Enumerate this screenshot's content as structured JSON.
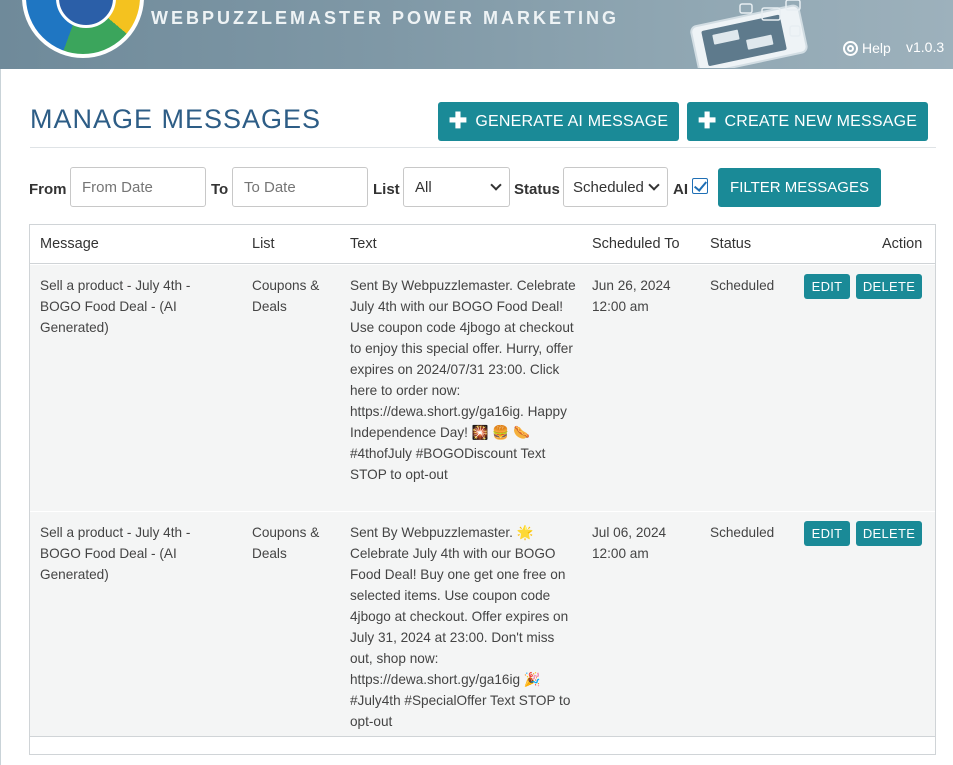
{
  "header": {
    "brand_tagline": "WEBPUZZLEMASTER POWER MARKETING",
    "help_label": "Help",
    "version": "v1.0.3"
  },
  "page": {
    "title": "MANAGE MESSAGES",
    "generate_ai_label": "GENERATE AI MESSAGE",
    "create_new_label": "CREATE NEW MESSAGE"
  },
  "filters": {
    "from_label": "From",
    "from_placeholder": "From Date",
    "to_label": "To",
    "to_placeholder": "To Date",
    "list_label": "List",
    "list_value": "All",
    "status_label": "Status",
    "status_value": "Scheduled",
    "ai_label": "AI",
    "ai_checked": true,
    "filter_button": "FILTER MESSAGES"
  },
  "table": {
    "columns": [
      "Message",
      "List",
      "Text",
      "Scheduled To",
      "Status",
      "Action"
    ],
    "rows": [
      {
        "message": "Sell a product - July 4th - BOGO Food Deal - (AI Generated)",
        "list": "Coupons & Deals",
        "text": "Sent By Webpuzzlemaster. Celebrate July 4th with our BOGO Food Deal! Use coupon code 4jbogo at checkout to enjoy this special offer. Hurry, offer expires on 2024/07/31 23:00. Click here to order now: https://dewa.short.gy/ga16ig. Happy Independence Day! 🎇 🍔 🌭 #4thofJuly #BOGODiscount Text STOP to opt-out",
        "scheduled": "Jun 26, 2024 12:00 am",
        "status": "Scheduled",
        "edit": "EDIT",
        "delete": "DELETE"
      },
      {
        "message": "Sell a product - July 4th - BOGO Food Deal - (AI Generated)",
        "list": "Coupons & Deals",
        "text": "Sent By Webpuzzlemaster. 🌟 Celebrate July 4th with our BOGO Food Deal! Buy one get one free on selected items. Use coupon code 4jbogo at checkout. Offer expires on July 31, 2024 at 23:00. Don't miss out, shop now: https://dewa.short.gy/ga16ig 🎉 #July4th #SpecialOffer Text STOP to opt-out",
        "scheduled": "Jul 06, 2024 12:00 am",
        "status": "Scheduled",
        "edit": "EDIT",
        "delete": "DELETE"
      }
    ]
  },
  "colors": {
    "accent": "#1a8a97",
    "title": "#2d5d86",
    "row_bg": "#f4f5f5",
    "banner": "#7f98a6"
  },
  "icons": [
    "help-lifebuoy-icon",
    "plus-icon",
    "chevron-down-icon",
    "checkbox-checked-icon",
    "phone-messages-illustration"
  ]
}
